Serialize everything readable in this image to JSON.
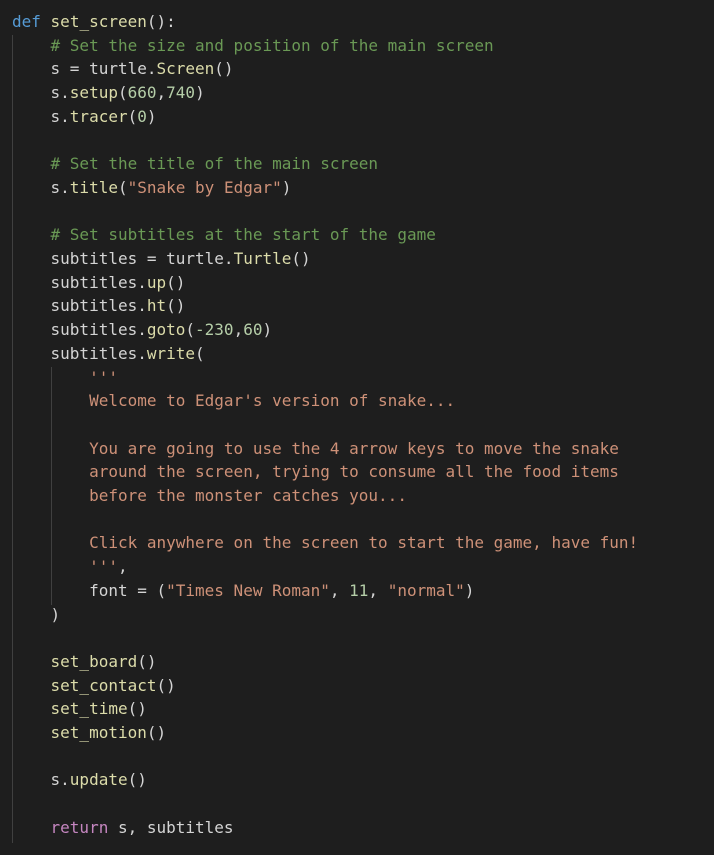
{
  "editor": {
    "colors": {
      "background": "#1e1e1e",
      "default_text": "#d4d4d4",
      "keyword": "#569cd6",
      "function": "#dcdcaa",
      "comment": "#6a9955",
      "string": "#ce9178",
      "number": "#b5cea8",
      "control_keyword": "#c586c0",
      "indent_guide": "#404040"
    },
    "lines": [
      [
        [
          "kw",
          "def"
        ],
        [
          "tx",
          " "
        ],
        [
          "fn",
          "set_screen"
        ],
        [
          "tx",
          "():"
        ]
      ],
      [
        [
          "tx",
          "    "
        ],
        [
          "cm",
          "# Set the size and position of the main screen"
        ]
      ],
      [
        [
          "tx",
          "    s = turtle."
        ],
        [
          "fn",
          "Screen"
        ],
        [
          "tx",
          "()"
        ]
      ],
      [
        [
          "tx",
          "    s."
        ],
        [
          "fn",
          "setup"
        ],
        [
          "tx",
          "("
        ],
        [
          "nm",
          "660"
        ],
        [
          "tx",
          ","
        ],
        [
          "nm",
          "740"
        ],
        [
          "tx",
          ")"
        ]
      ],
      [
        [
          "tx",
          "    s."
        ],
        [
          "fn",
          "tracer"
        ],
        [
          "tx",
          "("
        ],
        [
          "nm",
          "0"
        ],
        [
          "tx",
          ")"
        ]
      ],
      [],
      [
        [
          "tx",
          "    "
        ],
        [
          "cm",
          "# Set the title of the main screen"
        ]
      ],
      [
        [
          "tx",
          "    s."
        ],
        [
          "fn",
          "title"
        ],
        [
          "tx",
          "("
        ],
        [
          "st",
          "\"Snake by Edgar\""
        ],
        [
          "tx",
          ")"
        ]
      ],
      [],
      [
        [
          "tx",
          "    "
        ],
        [
          "cm",
          "# Set subtitles at the start of the game"
        ]
      ],
      [
        [
          "tx",
          "    subtitles = turtle."
        ],
        [
          "fn",
          "Turtle"
        ],
        [
          "tx",
          "()"
        ]
      ],
      [
        [
          "tx",
          "    subtitles."
        ],
        [
          "fn",
          "up"
        ],
        [
          "tx",
          "()"
        ]
      ],
      [
        [
          "tx",
          "    subtitles."
        ],
        [
          "fn",
          "ht"
        ],
        [
          "tx",
          "()"
        ]
      ],
      [
        [
          "tx",
          "    subtitles."
        ],
        [
          "fn",
          "goto"
        ],
        [
          "tx",
          "("
        ],
        [
          "nm",
          "-230"
        ],
        [
          "tx",
          ","
        ],
        [
          "nm",
          "60"
        ],
        [
          "tx",
          ")"
        ]
      ],
      [
        [
          "tx",
          "    subtitles."
        ],
        [
          "fn",
          "write"
        ],
        [
          "tx",
          "("
        ]
      ],
      [
        [
          "tx",
          "        "
        ],
        [
          "st",
          "'''"
        ]
      ],
      [
        [
          "tx",
          "        "
        ],
        [
          "st",
          "Welcome to Edgar's version of snake..."
        ]
      ],
      [],
      [
        [
          "tx",
          "        "
        ],
        [
          "st",
          "You are going to use the 4 arrow keys to move the snake"
        ]
      ],
      [
        [
          "tx",
          "        "
        ],
        [
          "st",
          "around the screen, trying to consume all the food items"
        ]
      ],
      [
        [
          "tx",
          "        "
        ],
        [
          "st",
          "before the monster catches you..."
        ]
      ],
      [],
      [
        [
          "tx",
          "        "
        ],
        [
          "st",
          "Click anywhere on the screen to start the game, have fun!"
        ]
      ],
      [
        [
          "tx",
          "        "
        ],
        [
          "st",
          "'''"
        ],
        [
          "tx",
          ","
        ]
      ],
      [
        [
          "tx",
          "        font = ("
        ],
        [
          "st",
          "\"Times New Roman\""
        ],
        [
          "tx",
          ", "
        ],
        [
          "nm",
          "11"
        ],
        [
          "tx",
          ", "
        ],
        [
          "st",
          "\"normal\""
        ],
        [
          "tx",
          ")"
        ]
      ],
      [
        [
          "tx",
          "    )"
        ]
      ],
      [],
      [
        [
          "tx",
          "    "
        ],
        [
          "fn",
          "set_board"
        ],
        [
          "tx",
          "()"
        ]
      ],
      [
        [
          "tx",
          "    "
        ],
        [
          "fn",
          "set_contact"
        ],
        [
          "tx",
          "()"
        ]
      ],
      [
        [
          "tx",
          "    "
        ],
        [
          "fn",
          "set_time"
        ],
        [
          "tx",
          "()"
        ]
      ],
      [
        [
          "tx",
          "    "
        ],
        [
          "fn",
          "set_motion"
        ],
        [
          "tx",
          "()"
        ]
      ],
      [],
      [
        [
          "tx",
          "    s."
        ],
        [
          "fn",
          "update"
        ],
        [
          "tx",
          "()"
        ]
      ],
      [],
      [
        [
          "tx",
          "    "
        ],
        [
          "kc",
          "return"
        ],
        [
          "tx",
          " s, subtitles"
        ]
      ]
    ]
  }
}
